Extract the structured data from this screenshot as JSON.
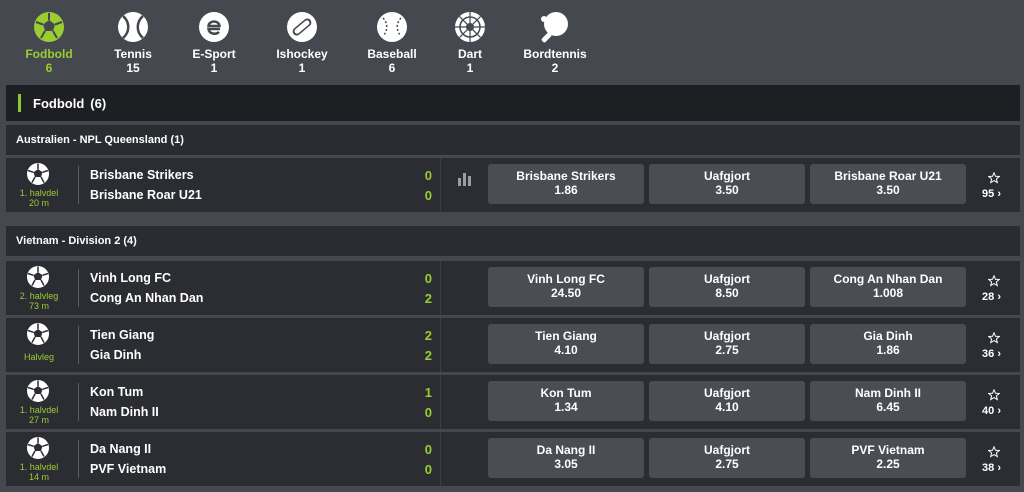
{
  "sports": [
    {
      "name": "Fodbold",
      "count": "6",
      "icon": "soccer-ball-icon",
      "active": true
    },
    {
      "name": "Tennis",
      "count": "15",
      "icon": "tennis-ball-icon",
      "active": false
    },
    {
      "name": "E-Sport",
      "count": "1",
      "icon": "esport-icon",
      "active": false
    },
    {
      "name": "Ishockey",
      "count": "1",
      "icon": "hockey-puck-icon",
      "active": false
    },
    {
      "name": "Baseball",
      "count": "6",
      "icon": "baseball-icon",
      "active": false
    },
    {
      "name": "Dart",
      "count": "1",
      "icon": "dartboard-icon",
      "active": false
    },
    {
      "name": "Bordtennis",
      "count": "2",
      "icon": "table-tennis-icon",
      "active": false
    }
  ],
  "section": {
    "title": "Fodbold",
    "count": "(6)"
  },
  "leagues": [
    {
      "name": "Australien - NPL Queensland (1)"
    },
    {
      "name": "Vietnam - Division 2 (4)"
    }
  ],
  "matches": [
    {
      "status": "1. halvdel",
      "minute": "20 m",
      "team1": "Brisbane Strikers",
      "team2": "Brisbane Roar U21",
      "score1": "0",
      "score2": "0",
      "odds": [
        {
          "label": "Brisbane Strikers",
          "value": "1.86"
        },
        {
          "label": "Uafgjort",
          "value": "3.50"
        },
        {
          "label": "Brisbane Roar U21",
          "value": "3.50"
        }
      ],
      "more": "95"
    },
    {
      "status": "2. halvleg",
      "minute": "73 m",
      "team1": "Vinh Long FC",
      "team2": "Cong An Nhan Dan",
      "score1": "0",
      "score2": "2",
      "odds": [
        {
          "label": "Vinh Long FC",
          "value": "24.50"
        },
        {
          "label": "Uafgjort",
          "value": "8.50"
        },
        {
          "label": "Cong An Nhan Dan",
          "value": "1.008"
        }
      ],
      "more": "28"
    },
    {
      "status": "Halvleg",
      "minute": "",
      "team1": "Tien Giang",
      "team2": "Gia Dinh",
      "score1": "2",
      "score2": "2",
      "odds": [
        {
          "label": "Tien Giang",
          "value": "4.10"
        },
        {
          "label": "Uafgjort",
          "value": "2.75"
        },
        {
          "label": "Gia Dinh",
          "value": "1.86"
        }
      ],
      "more": "36"
    },
    {
      "status": "1. halvdel",
      "minute": "27 m",
      "team1": "Kon Tum",
      "team2": "Nam Dinh II",
      "score1": "1",
      "score2": "0",
      "odds": [
        {
          "label": "Kon Tum",
          "value": "1.34"
        },
        {
          "label": "Uafgjort",
          "value": "4.10"
        },
        {
          "label": "Nam Dinh II",
          "value": "6.45"
        }
      ],
      "more": "40"
    },
    {
      "status": "1. halvdel",
      "minute": "14 m",
      "team1": "Da Nang II",
      "team2": "PVF Vietnam",
      "score1": "0",
      "score2": "0",
      "odds": [
        {
          "label": "Da Nang II",
          "value": "3.05"
        },
        {
          "label": "Uafgjort",
          "value": "2.75"
        },
        {
          "label": "PVF Vietnam",
          "value": "2.25"
        }
      ],
      "more": "38"
    }
  ],
  "colors": {
    "accent": "#9acd32",
    "bar": "#8cc63f",
    "background": "#45484f",
    "row": "#2b2d32",
    "header": "#1e1f23",
    "odd_button": "#4a4d54"
  }
}
